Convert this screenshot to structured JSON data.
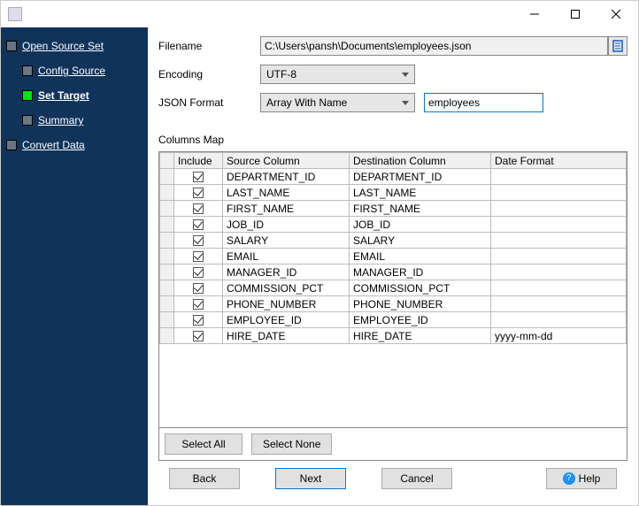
{
  "window": {},
  "sidebar": {
    "items": [
      {
        "label": "Open Source Set",
        "indent": false,
        "active": false
      },
      {
        "label": "Config Source",
        "indent": true,
        "active": false
      },
      {
        "label": "Set Target",
        "indent": true,
        "active": true
      },
      {
        "label": "Summary",
        "indent": true,
        "active": false
      },
      {
        "label": "Convert Data",
        "indent": false,
        "active": false
      }
    ]
  },
  "form": {
    "filename_label": "Filename",
    "filename_value": "C:\\Users\\pansh\\Documents\\employees.json",
    "encoding_label": "Encoding",
    "encoding_value": "UTF-8",
    "jsonformat_label": "JSON Format",
    "jsonformat_value": "Array With Name",
    "arrayname_value": "employees"
  },
  "columns": {
    "caption": "Columns Map",
    "headers": {
      "include": "Include",
      "source": "Source Column",
      "dest": "Destination Column",
      "datefmt": "Date Format"
    },
    "rows": [
      {
        "include": true,
        "src": "DEPARTMENT_ID",
        "dst": "DEPARTMENT_ID",
        "fmt": ""
      },
      {
        "include": true,
        "src": "LAST_NAME",
        "dst": "LAST_NAME",
        "fmt": ""
      },
      {
        "include": true,
        "src": "FIRST_NAME",
        "dst": "FIRST_NAME",
        "fmt": ""
      },
      {
        "include": true,
        "src": "JOB_ID",
        "dst": "JOB_ID",
        "fmt": ""
      },
      {
        "include": true,
        "src": "SALARY",
        "dst": "SALARY",
        "fmt": ""
      },
      {
        "include": true,
        "src": "EMAIL",
        "dst": "EMAIL",
        "fmt": ""
      },
      {
        "include": true,
        "src": "MANAGER_ID",
        "dst": "MANAGER_ID",
        "fmt": ""
      },
      {
        "include": true,
        "src": "COMMISSION_PCT",
        "dst": "COMMISSION_PCT",
        "fmt": ""
      },
      {
        "include": true,
        "src": "PHONE_NUMBER",
        "dst": "PHONE_NUMBER",
        "fmt": ""
      },
      {
        "include": true,
        "src": "EMPLOYEE_ID",
        "dst": "EMPLOYEE_ID",
        "fmt": ""
      },
      {
        "include": true,
        "src": "HIRE_DATE",
        "dst": "HIRE_DATE",
        "fmt": "yyyy-mm-dd"
      }
    ]
  },
  "buttons": {
    "select_all": "Select All",
    "select_none": "Select None",
    "back": "Back",
    "next": "Next",
    "cancel": "Cancel",
    "help": "Help"
  }
}
